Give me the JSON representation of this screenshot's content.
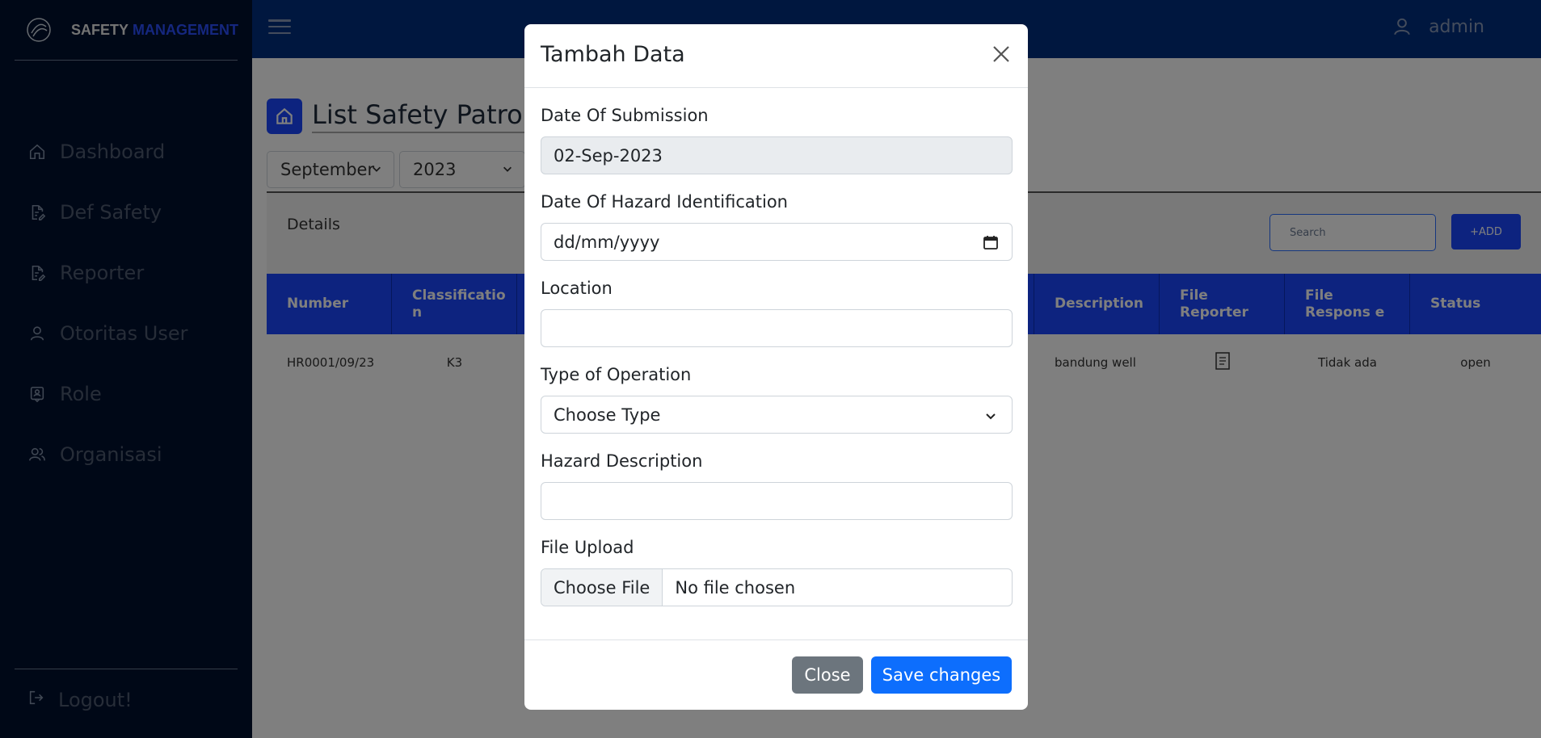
{
  "brand": {
    "text_main": "SAFETY",
    "text_accent": "MANAGEMENT"
  },
  "sidebar": {
    "items": [
      {
        "label": "Dashboard",
        "icon": "home-icon"
      },
      {
        "label": "Def Safety",
        "icon": "document-edit-icon"
      },
      {
        "label": "Reporter",
        "icon": "document-edit-icon"
      },
      {
        "label": "Otoritas User",
        "icon": "user-icon"
      },
      {
        "label": "Role",
        "icon": "badge-icon"
      },
      {
        "label": "Organisasi",
        "icon": "users-icon"
      }
    ],
    "logout_label": "Logout!"
  },
  "topbar": {
    "username": "admin"
  },
  "page": {
    "title": "List Safety Patrol!",
    "month_select": "September",
    "year_select": "2023",
    "details_label": "Details",
    "search_placeholder": "Search",
    "add_label": "+ADD"
  },
  "table": {
    "headers": [
      "Number",
      "Classificatio n",
      "Description",
      "File Reporter",
      "File Respons e",
      "Status"
    ],
    "rows": [
      {
        "number": "HR0001/09/23",
        "classification": "K3",
        "description": "bandung well",
        "file_reporter": "document-icon",
        "file_response": "Tidak ada",
        "status": "open"
      }
    ]
  },
  "modal": {
    "title": "Tambah Data",
    "fields": {
      "date_submission_label": "Date Of Submission",
      "date_submission_value": "02-Sep-2023",
      "date_hazard_label": "Date Of Hazard Identification",
      "date_hazard_placeholder": "dd/mm/yyyy",
      "location_label": "Location",
      "location_value": "",
      "type_label": "Type of Operation",
      "type_value": "Choose Type",
      "hazard_desc_label": "Hazard Description",
      "hazard_desc_value": "",
      "file_label": "File Upload",
      "file_button": "Choose File",
      "file_status": "No file chosen"
    },
    "close_label": "Close",
    "save_label": "Save changes"
  },
  "colors": {
    "sidebar_bg": "#00112e",
    "topbar_bg": "#002f7e",
    "accent_blue": "#1a47ff",
    "primary_button": "#0d6efd",
    "secondary_button": "#6c757d"
  }
}
